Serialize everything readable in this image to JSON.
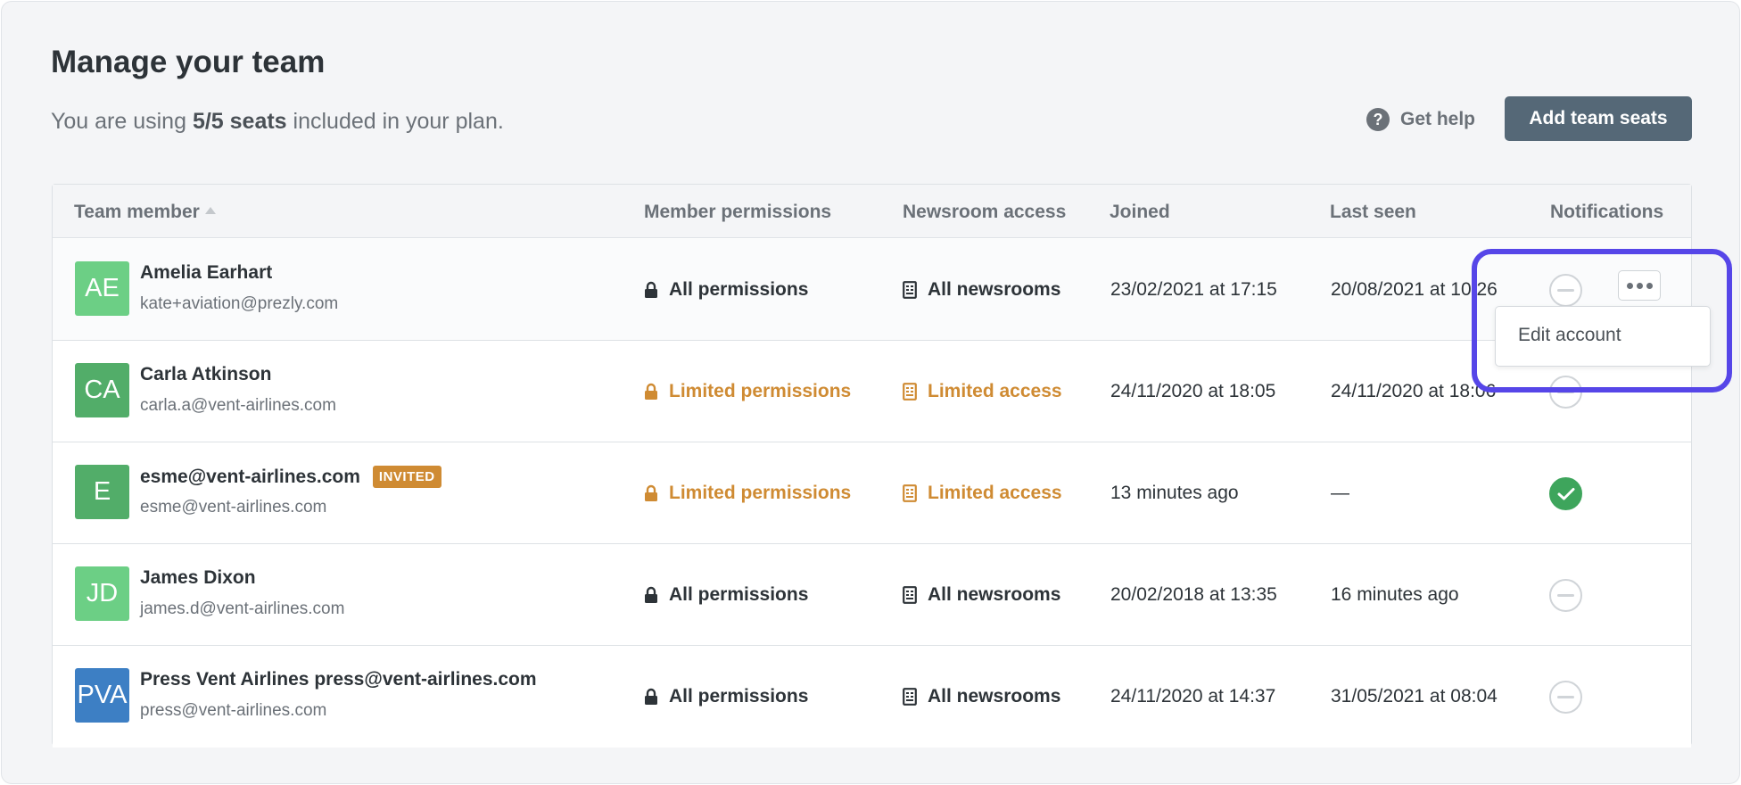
{
  "header": {
    "title": "Manage your team",
    "subtitle_prefix": "You are using ",
    "subtitle_seats": "5/5 seats",
    "subtitle_suffix": " included in your plan.",
    "help_label": "Get help",
    "help_icon": "?",
    "add_seats_label": "Add team seats"
  },
  "table": {
    "columns": [
      "Team member",
      "Member permissions",
      "Newsroom access",
      "Joined",
      "Last seen",
      "Notifications"
    ],
    "rows": [
      {
        "initials": "AE",
        "avatar_color": "#6ccf85",
        "name": "Amelia Earhart",
        "email": "kate+aviation@prezly.com",
        "badge": "",
        "permissions": "All permissions",
        "permissions_style": "full",
        "access": "All newsrooms",
        "access_style": "full",
        "joined": "23/02/2021 at 17:15",
        "last_seen": "20/08/2021 at 10:26",
        "notifications": "off"
      },
      {
        "initials": "CA",
        "avatar_color": "#52ad69",
        "name": "Carla Atkinson",
        "email": "carla.a@vent-airlines.com",
        "badge": "",
        "permissions": "Limited permissions",
        "permissions_style": "limited",
        "access": "Limited access",
        "access_style": "limited",
        "joined": "24/11/2020 at 18:05",
        "last_seen": "24/11/2020 at 18:06",
        "notifications": "off"
      },
      {
        "initials": "E",
        "avatar_color": "#52ad69",
        "name": "esme@vent-airlines.com",
        "email": "esme@vent-airlines.com",
        "badge": "INVITED",
        "permissions": "Limited permissions",
        "permissions_style": "limited",
        "access": "Limited access",
        "access_style": "limited",
        "joined": "13 minutes ago",
        "last_seen": "—",
        "notifications": "on"
      },
      {
        "initials": "JD",
        "avatar_color": "#6ccf85",
        "name": "James Dixon",
        "email": "james.d@vent-airlines.com",
        "badge": "",
        "permissions": "All permissions",
        "permissions_style": "full",
        "access": "All newsrooms",
        "access_style": "full",
        "joined": "20/02/2018 at 13:35",
        "last_seen": "16 minutes ago",
        "notifications": "off"
      },
      {
        "initials": "PVA",
        "avatar_color": "#3d7fc4",
        "name": "Press Vent Airlines press@vent-airlines.com",
        "email": "press@vent-airlines.com",
        "badge": "",
        "permissions": "All permissions",
        "permissions_style": "full",
        "access": "All newsrooms",
        "access_style": "full",
        "joined": "24/11/2020 at 14:37",
        "last_seen": "31/05/2021 at 08:04",
        "notifications": "off"
      }
    ]
  },
  "row_menu": {
    "trigger_icon": "more-dots-icon",
    "items": [
      "Edit account"
    ]
  },
  "colors": {
    "limited": "#cf8b33",
    "full": "#2d3338",
    "primary_button": "#556877",
    "highlight": "#5646e8",
    "notification_on": "#3ea55c"
  }
}
